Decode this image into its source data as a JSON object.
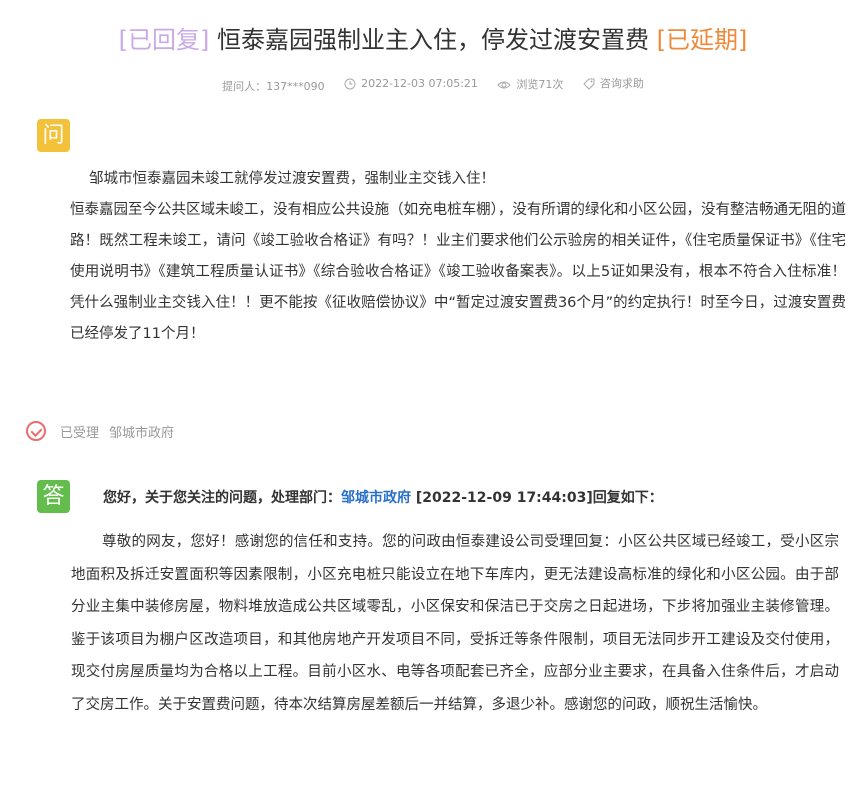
{
  "title": {
    "tag_replied": "[已回复]",
    "text": "恒泰嘉园强制业主入住，停发过渡安置费",
    "tag_extended": "[已延期]"
  },
  "meta": {
    "asker": "提问人：137***090",
    "time": "2022-12-03 07:05:21",
    "views": "浏览71次",
    "category": "咨询求助"
  },
  "question": {
    "badge": "问",
    "first_line": "邹城市恒泰嘉园未竣工就停发过渡安置费，强制业主交钱入住！",
    "body": "恒泰嘉园至今公共区域未峻工，没有相应公共设施（如充电桩车棚），没有所谓的绿化和小区公园，没有整洁畅通无阻的道路！既然工程未竣工，请问《竣工验收合格证》有吗？！业主们要求他们公示验房的相关证件，《住宅质量保证书》《住宅使用说明书》《建筑工程质量认证书》《综合验收合格证》《竣工验收备案表》。以上5证如果没有，根本不符合入住标准！凭什么强制业主交钱入住！！更不能按《征收赔偿协议》中“暂定过渡安置费36个月”的约定执行！时至今日，过渡安置费已经停发了11个月！"
  },
  "status": {
    "state": "已受理",
    "department": "邹城市政府"
  },
  "answer": {
    "badge": "答",
    "head_prefix": "您好，关于您关注的问题，处理部门：",
    "department": "邹城市政府",
    "head_suffix": " [2022-12-09 17:44:03]回复如下：",
    "body": "尊敬的网友，您好！感谢您的信任和支持。您的问政由恒泰建设公司受理回复：小区公共区域已经竣工，受小区宗地面积及拆迁安置面积等因素限制，小区充电桩只能设立在地下车库内，更无法建设高标准的绿化和小区公园。由于部分业主集中装修房屋，物料堆放造成公共区域零乱，小区保安和保洁已于交房之日起进场，下步将加强业主装修管理。鉴于该项目为棚户区改造项目，和其他房地产开发项目不同，受拆迁等条件限制，项目无法同步开工建设及交付使用，现交付房屋质量均为合格以上工程。目前小区水、电等各项配套已齐全，应部分业主要求，在具备入住条件后，才启动了交房工作。关于安置费问题，待本次结算房屋差额后一并结算，多退少补。感谢您的问政，顺祝生活愉快。"
  },
  "icons": {
    "clock": "clock-icon",
    "eye": "eye-icon",
    "tag": "tag-icon",
    "check": "check-circle-icon"
  },
  "colors": {
    "tag_replied": "#c9a9e8",
    "tag_extended": "#ee8a3a",
    "question_badge": "#f3c13a",
    "answer_badge": "#62bd4d",
    "link": "#2a70c8",
    "status_check": "#e96d6d"
  }
}
